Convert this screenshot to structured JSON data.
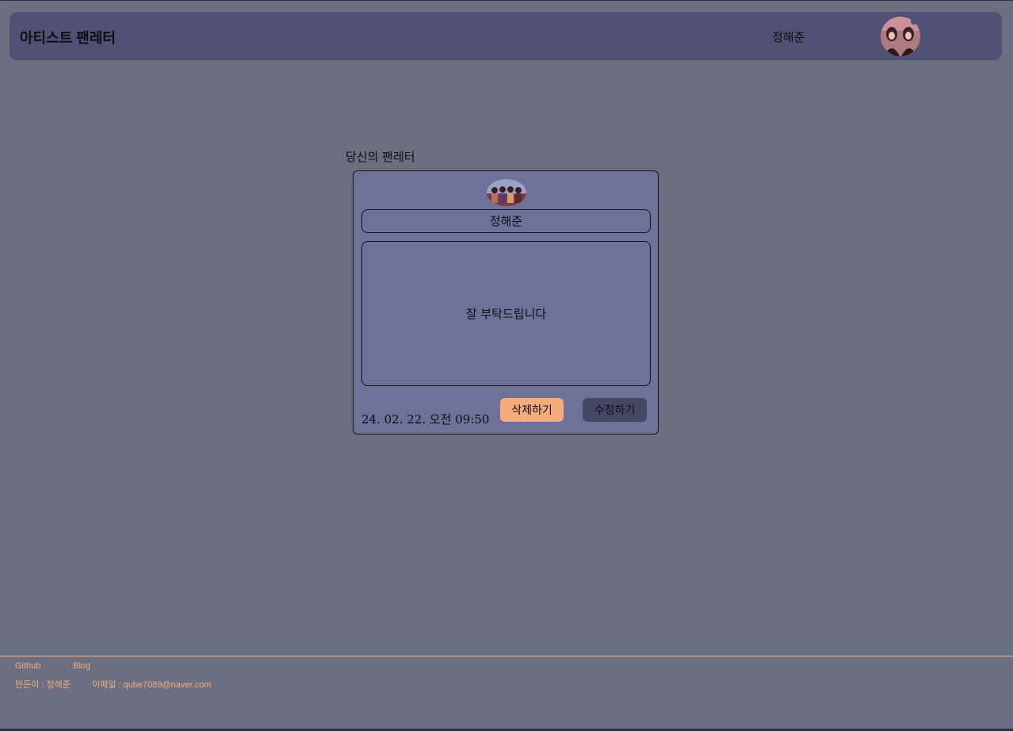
{
  "header": {
    "app_title": "아티스트 팬레터",
    "user_name": "정해준",
    "avatar_icon": "profile-photo"
  },
  "section": {
    "label": "당신의 팬레터"
  },
  "letter": {
    "avatar_icon": "profile-photo",
    "nickname": "정해준",
    "content": "잘 부탁드립니다",
    "date": "24. 02. 22. 오전 09:50",
    "delete_label": "삭제하기",
    "edit_label": "수정하기"
  },
  "footer": {
    "github_label": "Github",
    "blog_label": "Blog",
    "maker": "만든이 : 정해준",
    "email": "이메일 : qube7089@naver.com"
  },
  "colors": {
    "background": "#6b6f80",
    "header": "#4f5274",
    "card": "#6e7198",
    "accent": "#f4ac7b",
    "edit_button": "#454865"
  }
}
